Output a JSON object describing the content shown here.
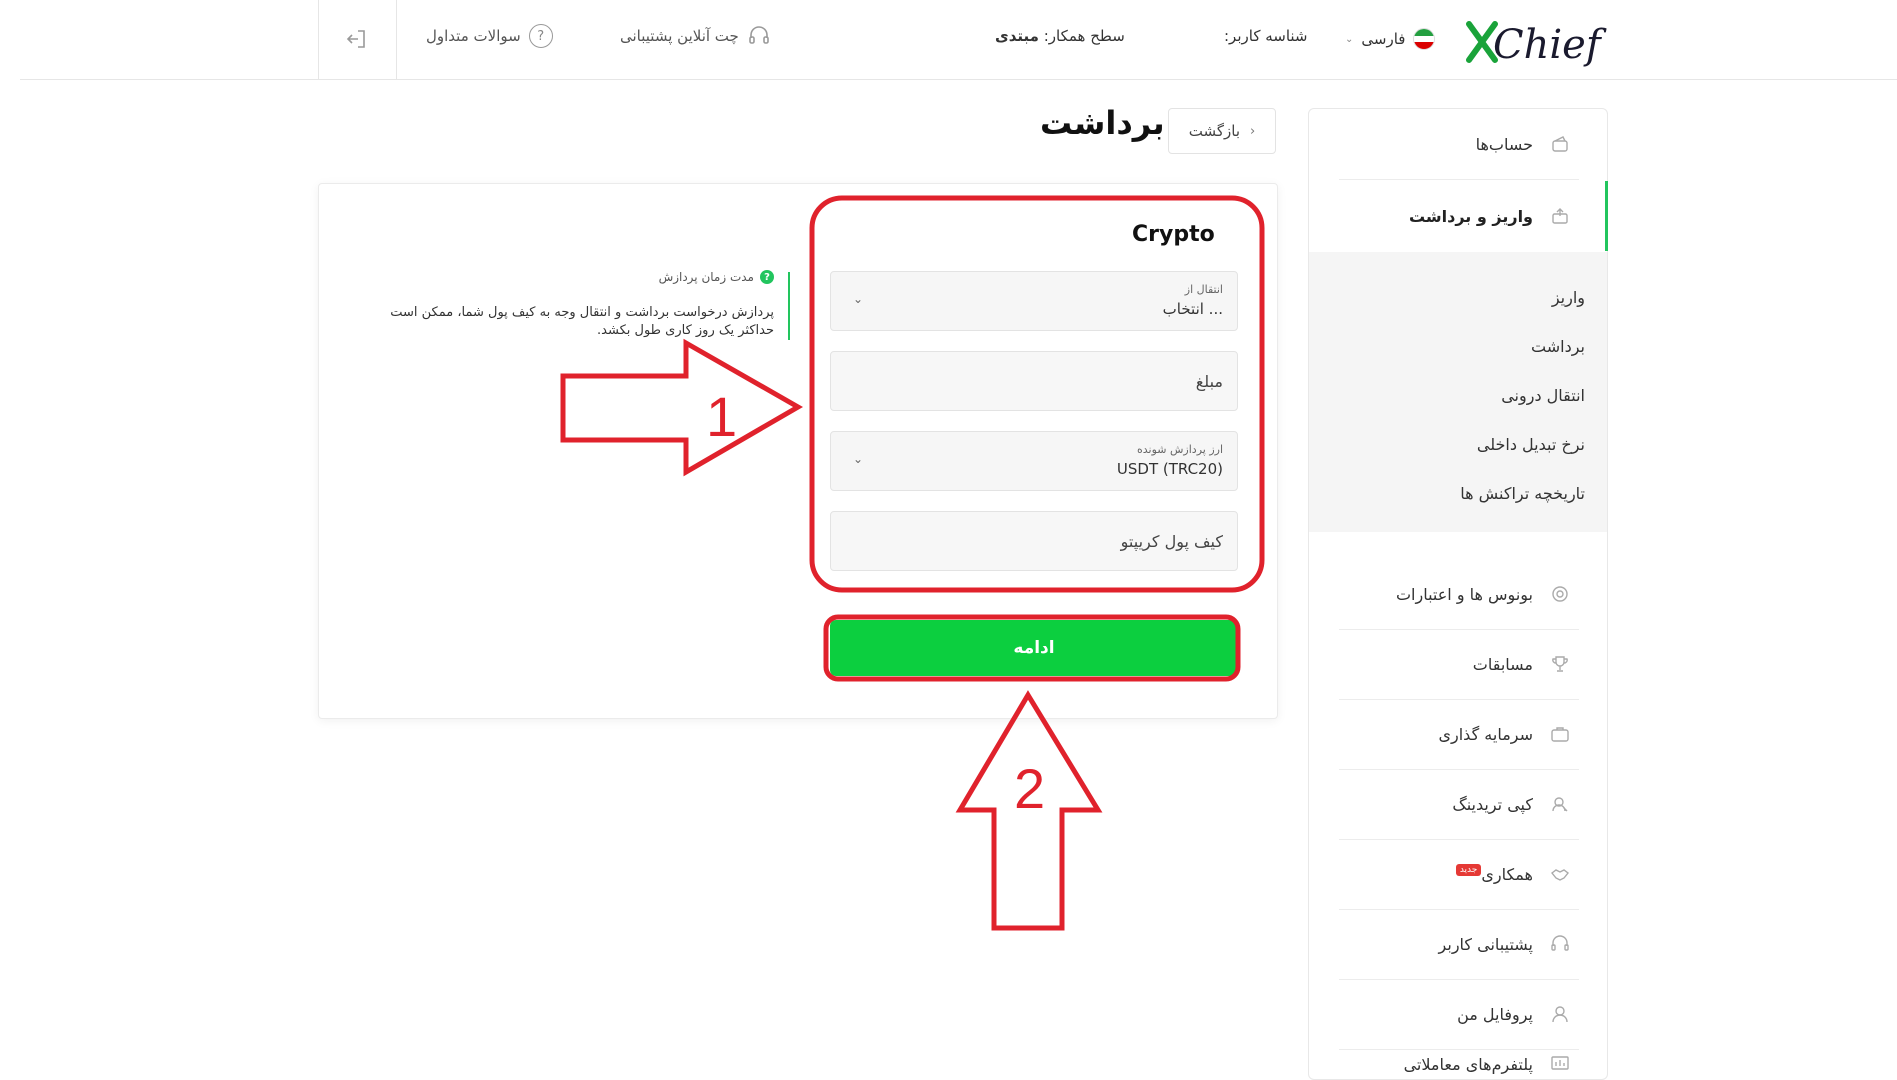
{
  "header": {
    "logo_text": "XChief",
    "language": "فارسی",
    "user_id_label": "شناسه کاربر:",
    "partner_level_label": "سطح همکار:",
    "partner_level_value": "مبتدی",
    "support_chat": "چت آنلاین پشتیبانی",
    "faq": "سوالات متداول"
  },
  "sidebar": {
    "items": [
      {
        "label": "حساب‌ها",
        "icon": "wallet-icon"
      },
      {
        "label": "واریز و برداشت",
        "icon": "transfer-icon"
      },
      {
        "label": "بونوس ها و اعتبارات",
        "icon": "bonus-icon"
      },
      {
        "label": "مسابقات",
        "icon": "trophy-icon"
      },
      {
        "label": "سرمایه گذاری",
        "icon": "briefcase-icon"
      },
      {
        "label": "کپی تریدینگ",
        "icon": "copy-trading-icon"
      },
      {
        "label": "همکاری",
        "icon": "handshake-icon",
        "badge": "جدید"
      },
      {
        "label": "پشتیبانی کاربر",
        "icon": "headset-icon"
      },
      {
        "label": "پروفایل من",
        "icon": "user-icon"
      },
      {
        "label": "پلتفرم‌های معاملاتی",
        "icon": "platform-icon"
      }
    ],
    "sub_items": [
      "واریز",
      "برداشت",
      "انتقال درونی",
      "نرخ تبدیل داخلی",
      "تاریخچه تراکنش ها"
    ]
  },
  "page": {
    "back_label": "بازگشت",
    "title": "برداشت"
  },
  "form": {
    "section_title": "Crypto",
    "transfer_from_label": "انتقال از",
    "transfer_from_value": "... انتخاب",
    "amount_placeholder": "مبلغ",
    "currency_label": "ارز پردازش شونده",
    "currency_value": "USDT (TRC20)",
    "wallet_placeholder": "کیف پول کریپتو",
    "continue_label": "ادامه"
  },
  "info": {
    "heading": "مدت زمان پردازش",
    "body": "پردازش درخواست برداشت و انتقال وجه به کیف پول شما، ممکن است حداکثر یک روز کاری طول بکشد."
  },
  "annotations": {
    "step1": "1",
    "step2": "2",
    "color": "#e0222c"
  }
}
